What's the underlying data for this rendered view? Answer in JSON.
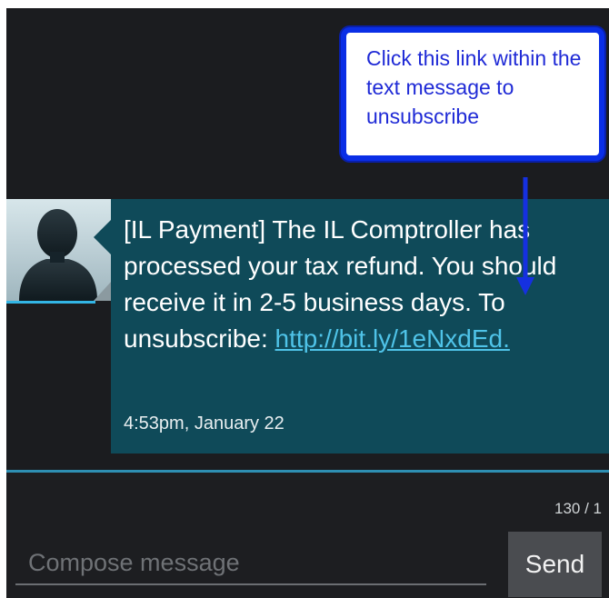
{
  "message": {
    "text_intro": "[IL Payment]  The IL Comptroller has processed your tax refund. You should receive it in 2-5 business days. To unsubscribe: ",
    "link": "http://bit.ly/1eNxdEd.",
    "time": "4:53pm, January 22"
  },
  "callout": {
    "text": "Click this link within the text message to unsubscribe"
  },
  "compose": {
    "placeholder": "Compose message",
    "char_count": "130 / 1",
    "send_label": "Send"
  },
  "colors": {
    "bubble": "#0f4a59",
    "link": "#4fc3e8",
    "callout_border": "#0a2ee6",
    "callout_text": "#1f2ad6",
    "divider": "#2e8fb3"
  },
  "icons": {
    "avatar": "person-silhouette-icon",
    "arrow": "arrow-down-icon"
  }
}
